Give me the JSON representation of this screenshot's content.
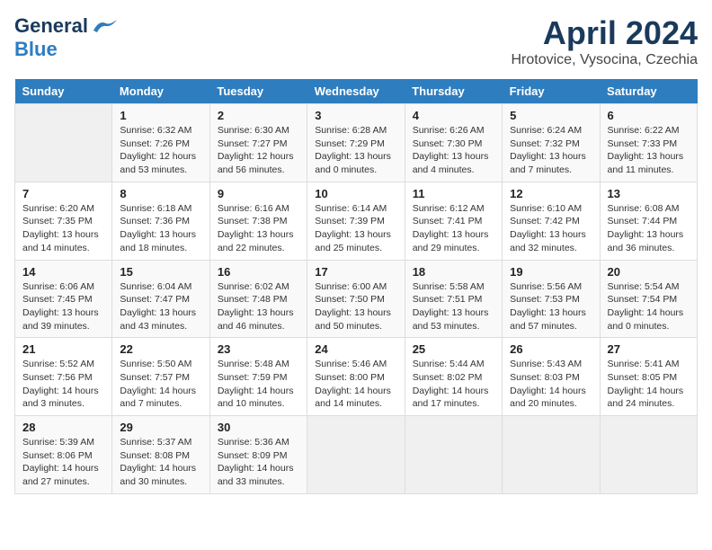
{
  "header": {
    "logo_general": "General",
    "logo_blue": "Blue",
    "title": "April 2024",
    "location": "Hrotovice, Vysocina, Czechia"
  },
  "calendar": {
    "weekdays": [
      "Sunday",
      "Monday",
      "Tuesday",
      "Wednesday",
      "Thursday",
      "Friday",
      "Saturday"
    ],
    "weeks": [
      [
        {
          "day": "",
          "info": ""
        },
        {
          "day": "1",
          "info": "Sunrise: 6:32 AM\nSunset: 7:26 PM\nDaylight: 12 hours\nand 53 minutes."
        },
        {
          "day": "2",
          "info": "Sunrise: 6:30 AM\nSunset: 7:27 PM\nDaylight: 12 hours\nand 56 minutes."
        },
        {
          "day": "3",
          "info": "Sunrise: 6:28 AM\nSunset: 7:29 PM\nDaylight: 13 hours\nand 0 minutes."
        },
        {
          "day": "4",
          "info": "Sunrise: 6:26 AM\nSunset: 7:30 PM\nDaylight: 13 hours\nand 4 minutes."
        },
        {
          "day": "5",
          "info": "Sunrise: 6:24 AM\nSunset: 7:32 PM\nDaylight: 13 hours\nand 7 minutes."
        },
        {
          "day": "6",
          "info": "Sunrise: 6:22 AM\nSunset: 7:33 PM\nDaylight: 13 hours\nand 11 minutes."
        }
      ],
      [
        {
          "day": "7",
          "info": "Sunrise: 6:20 AM\nSunset: 7:35 PM\nDaylight: 13 hours\nand 14 minutes."
        },
        {
          "day": "8",
          "info": "Sunrise: 6:18 AM\nSunset: 7:36 PM\nDaylight: 13 hours\nand 18 minutes."
        },
        {
          "day": "9",
          "info": "Sunrise: 6:16 AM\nSunset: 7:38 PM\nDaylight: 13 hours\nand 22 minutes."
        },
        {
          "day": "10",
          "info": "Sunrise: 6:14 AM\nSunset: 7:39 PM\nDaylight: 13 hours\nand 25 minutes."
        },
        {
          "day": "11",
          "info": "Sunrise: 6:12 AM\nSunset: 7:41 PM\nDaylight: 13 hours\nand 29 minutes."
        },
        {
          "day": "12",
          "info": "Sunrise: 6:10 AM\nSunset: 7:42 PM\nDaylight: 13 hours\nand 32 minutes."
        },
        {
          "day": "13",
          "info": "Sunrise: 6:08 AM\nSunset: 7:44 PM\nDaylight: 13 hours\nand 36 minutes."
        }
      ],
      [
        {
          "day": "14",
          "info": "Sunrise: 6:06 AM\nSunset: 7:45 PM\nDaylight: 13 hours\nand 39 minutes."
        },
        {
          "day": "15",
          "info": "Sunrise: 6:04 AM\nSunset: 7:47 PM\nDaylight: 13 hours\nand 43 minutes."
        },
        {
          "day": "16",
          "info": "Sunrise: 6:02 AM\nSunset: 7:48 PM\nDaylight: 13 hours\nand 46 minutes."
        },
        {
          "day": "17",
          "info": "Sunrise: 6:00 AM\nSunset: 7:50 PM\nDaylight: 13 hours\nand 50 minutes."
        },
        {
          "day": "18",
          "info": "Sunrise: 5:58 AM\nSunset: 7:51 PM\nDaylight: 13 hours\nand 53 minutes."
        },
        {
          "day": "19",
          "info": "Sunrise: 5:56 AM\nSunset: 7:53 PM\nDaylight: 13 hours\nand 57 minutes."
        },
        {
          "day": "20",
          "info": "Sunrise: 5:54 AM\nSunset: 7:54 PM\nDaylight: 14 hours\nand 0 minutes."
        }
      ],
      [
        {
          "day": "21",
          "info": "Sunrise: 5:52 AM\nSunset: 7:56 PM\nDaylight: 14 hours\nand 3 minutes."
        },
        {
          "day": "22",
          "info": "Sunrise: 5:50 AM\nSunset: 7:57 PM\nDaylight: 14 hours\nand 7 minutes."
        },
        {
          "day": "23",
          "info": "Sunrise: 5:48 AM\nSunset: 7:59 PM\nDaylight: 14 hours\nand 10 minutes."
        },
        {
          "day": "24",
          "info": "Sunrise: 5:46 AM\nSunset: 8:00 PM\nDaylight: 14 hours\nand 14 minutes."
        },
        {
          "day": "25",
          "info": "Sunrise: 5:44 AM\nSunset: 8:02 PM\nDaylight: 14 hours\nand 17 minutes."
        },
        {
          "day": "26",
          "info": "Sunrise: 5:43 AM\nSunset: 8:03 PM\nDaylight: 14 hours\nand 20 minutes."
        },
        {
          "day": "27",
          "info": "Sunrise: 5:41 AM\nSunset: 8:05 PM\nDaylight: 14 hours\nand 24 minutes."
        }
      ],
      [
        {
          "day": "28",
          "info": "Sunrise: 5:39 AM\nSunset: 8:06 PM\nDaylight: 14 hours\nand 27 minutes."
        },
        {
          "day": "29",
          "info": "Sunrise: 5:37 AM\nSunset: 8:08 PM\nDaylight: 14 hours\nand 30 minutes."
        },
        {
          "day": "30",
          "info": "Sunrise: 5:36 AM\nSunset: 8:09 PM\nDaylight: 14 hours\nand 33 minutes."
        },
        {
          "day": "",
          "info": ""
        },
        {
          "day": "",
          "info": ""
        },
        {
          "day": "",
          "info": ""
        },
        {
          "day": "",
          "info": ""
        }
      ]
    ]
  }
}
